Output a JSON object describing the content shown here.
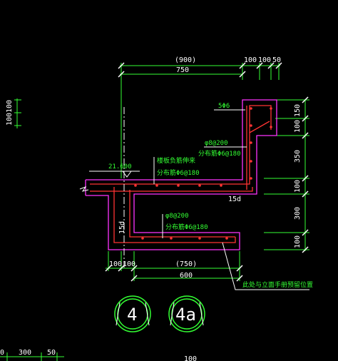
{
  "top_dims": {
    "overall": "(900)",
    "span": "750",
    "d1": "100",
    "d2": "100",
    "d3": "50"
  },
  "left_dims": {
    "a": "100",
    "b": "100"
  },
  "right_dims": {
    "r1": "150",
    "r2": "100",
    "r3": "350",
    "r4": "100",
    "r5": "300",
    "r6": "100"
  },
  "bottom_dims": {
    "b1": "100",
    "b2": "100",
    "b3": "(750)",
    "b4": "600"
  },
  "labels": {
    "rebar_top": "5Φ6",
    "rebar_wall_1": "φ8@200",
    "rebar_wall_2": "分布筋Φ6@180",
    "rebar_slab_1": "楼板负筋伸来",
    "rebar_slab_2": "分布筋Φ6@180",
    "rebar_lower_1": "φ8@200",
    "rebar_lower_2": "分布筋Φ6@180",
    "elevation": "21.600",
    "anchor_top": "15d",
    "anchor_side": "15d",
    "leader_note": "此处与立面手册预留位置"
  },
  "section_marks": {
    "left": "4",
    "right": "4a"
  },
  "footer": {
    "d1": "0",
    "d2": "300",
    "d3": "50",
    "d4": "100"
  },
  "colors": {
    "dimension": "#33ff33",
    "outline": "#ff33ff",
    "rebar": "#ff3333",
    "text": "#ffffff"
  }
}
